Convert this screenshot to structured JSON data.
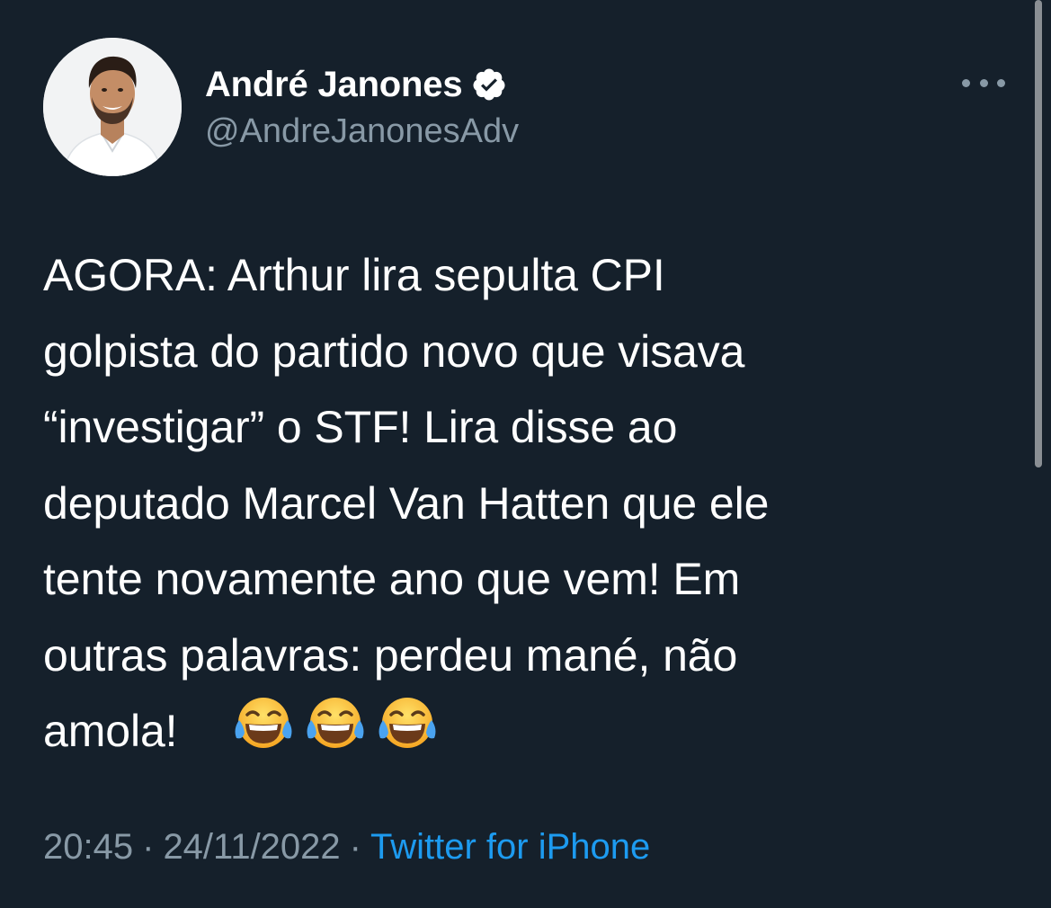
{
  "author": {
    "display_name": "André Janones",
    "handle": "@AndreJanonesAdv",
    "verified": true
  },
  "icons": {
    "avatar": "profile-photo",
    "verified": "verified-badge-icon",
    "more": "more-options-icon",
    "emoji": "face-with-tears-of-joy-emoji"
  },
  "tweet": {
    "text": "AGORA: Arthur lira sepulta CPI\ngolpista do partido novo que visava\n“investigar” o STF! Lira disse ao\ndeputado Marcel Van Hatten que ele\ntente novamente ano que vem! Em\noutras palavras: perdeu mané, não\namola!",
    "emoji_count": 3
  },
  "meta": {
    "time": "20:45",
    "separator": "·",
    "date": "24/11/2022",
    "source": "Twitter for iPhone"
  },
  "colors": {
    "background": "#15202b",
    "text": "#ffffff",
    "secondary": "#8899a6",
    "link": "#1d9bf0"
  }
}
